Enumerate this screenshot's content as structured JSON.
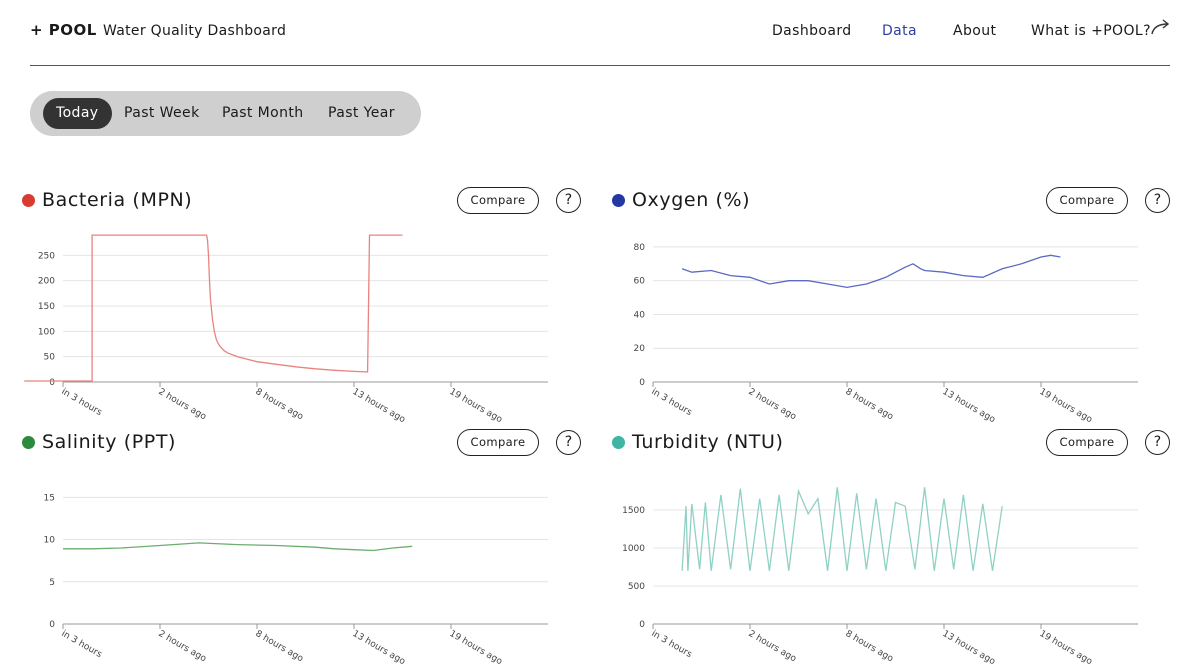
{
  "header": {
    "logo": "+ POOL",
    "subtitle": "Water Quality Dashboard",
    "nav": [
      {
        "label": "Dashboard",
        "active": false
      },
      {
        "label": "Data",
        "active": true
      },
      {
        "label": "About",
        "active": false
      },
      {
        "label": "What is +POOL?",
        "active": false
      }
    ],
    "nav_icon": "arrow-curve-right-icon"
  },
  "time_ranges": [
    {
      "label": "Today",
      "active": true
    },
    {
      "label": "Past Week",
      "active": false
    },
    {
      "label": "Past Month",
      "active": false
    },
    {
      "label": "Past Year",
      "active": false
    }
  ],
  "panel_controls": {
    "compare_label": "Compare",
    "help_label": "?"
  },
  "colors": {
    "accent": "#2f3fa0"
  },
  "chart_data": [
    {
      "id": "bacteria",
      "type": "line",
      "title": "Bacteria (MPN)",
      "color": "#e8837f",
      "dot_color": "#d93b33",
      "ylim": [
        0,
        300
      ],
      "xlim": [
        -3,
        22
      ],
      "yticks": [
        0,
        50,
        100,
        150,
        200,
        250
      ],
      "xtick_labels": [
        "in 3 hours",
        "2 hours ago",
        "8 hours ago",
        "13 hours ago",
        "19 hours ago"
      ],
      "xtick_positions": [
        -3,
        2,
        7,
        12,
        17
      ],
      "grid": true,
      "x": [
        14.5,
        12.8,
        12.7,
        12,
        11,
        10,
        9,
        8,
        7,
        6,
        5.5,
        5.3,
        5.2,
        5.1,
        5.0,
        4.9,
        4.8,
        4.7,
        4.6,
        4.55,
        4.5,
        4.45,
        4.4,
        4.3,
        -1.5,
        -1.5,
        -1.6,
        -5
      ],
      "values": [
        290,
        290,
        20,
        21,
        23,
        26,
        30,
        35,
        40,
        50,
        57,
        62,
        66,
        70,
        76,
        84,
        100,
        125,
        165,
        200,
        250,
        280,
        290,
        290,
        290,
        2,
        2,
        2
      ]
    },
    {
      "id": "oxygen",
      "type": "line",
      "title": "Oxygen (%)",
      "color": "#5a69c2",
      "dot_color": "#2338a3",
      "ylim": [
        0,
        90
      ],
      "xlim": [
        -3,
        22
      ],
      "yticks": [
        0,
        20,
        40,
        60,
        80
      ],
      "xtick_labels": [
        "in 3 hours",
        "2 hours ago",
        "8 hours ago",
        "13 hours ago",
        "19 hours ago"
      ],
      "xtick_positions": [
        -3,
        2,
        7,
        12,
        17
      ],
      "grid": true,
      "x": [
        -1.5,
        -1,
        0,
        1,
        2,
        3,
        4,
        5,
        6,
        7,
        8,
        8.5,
        9,
        9.5,
        10,
        10.4,
        10.8,
        11,
        12,
        13,
        14,
        15,
        16,
        17,
        17.5,
        18
      ],
      "values": [
        67,
        65,
        66,
        63,
        62,
        58,
        60,
        60,
        58,
        56,
        58,
        60,
        62,
        65,
        68,
        70,
        67,
        66,
        65,
        63,
        62,
        67,
        70,
        74,
        75,
        74
      ]
    },
    {
      "id": "salinity",
      "type": "line",
      "title": "Salinity (PPT)",
      "color": "#6aad6f",
      "dot_color": "#2b8a3e",
      "ylim": [
        0,
        18
      ],
      "xlim": [
        -3,
        22
      ],
      "yticks": [
        0,
        5,
        10,
        15
      ],
      "xtick_labels": [
        "in 3 hours",
        "2 hours ago",
        "8 hours ago",
        "13 hours ago",
        "19 hours ago"
      ],
      "xtick_positions": [
        -3,
        2,
        7,
        12,
        17
      ],
      "grid": true,
      "x": [
        -3,
        -1.5,
        0,
        2,
        4,
        6,
        8,
        10,
        11,
        12,
        13,
        14,
        15
      ],
      "values": [
        8.9,
        8.9,
        9.0,
        9.3,
        9.6,
        9.4,
        9.3,
        9.1,
        8.9,
        8.8,
        8.7,
        9.0,
        9.2
      ]
    },
    {
      "id": "turbidity",
      "type": "line",
      "title": "Turbidity (NTU)",
      "color": "#8fd1c4",
      "dot_color": "#3fb5a5",
      "ylim": [
        0,
        2000
      ],
      "xlim": [
        -3,
        22
      ],
      "yticks": [
        0,
        500,
        1000,
        1500
      ],
      "xtick_labels": [
        "in 3 hours",
        "2 hours ago",
        "8 hours ago",
        "13 hours ago",
        "19 hours ago"
      ],
      "xtick_positions": [
        -3,
        2,
        7,
        12,
        17
      ],
      "grid": true,
      "x": [
        -1.5,
        -1.3,
        -1.2,
        -1.0,
        -0.6,
        -0.3,
        0,
        0.5,
        1,
        1.5,
        2,
        2.5,
        3,
        3.5,
        4,
        4.5,
        5,
        5.5,
        6,
        6.5,
        7,
        7.5,
        8,
        8.5,
        9,
        9.5,
        10,
        10.5,
        11,
        11.5,
        12,
        12.5,
        13,
        13.5,
        14,
        14.5,
        15
      ],
      "values": [
        700,
        1550,
        700,
        1580,
        720,
        1600,
        700,
        1700,
        720,
        1780,
        700,
        1650,
        700,
        1700,
        700,
        1750,
        1450,
        1650,
        700,
        1800,
        700,
        1720,
        720,
        1650,
        700,
        1600,
        1550,
        720,
        1800,
        700,
        1650,
        720,
        1700,
        700,
        1580,
        700,
        1550
      ]
    }
  ]
}
